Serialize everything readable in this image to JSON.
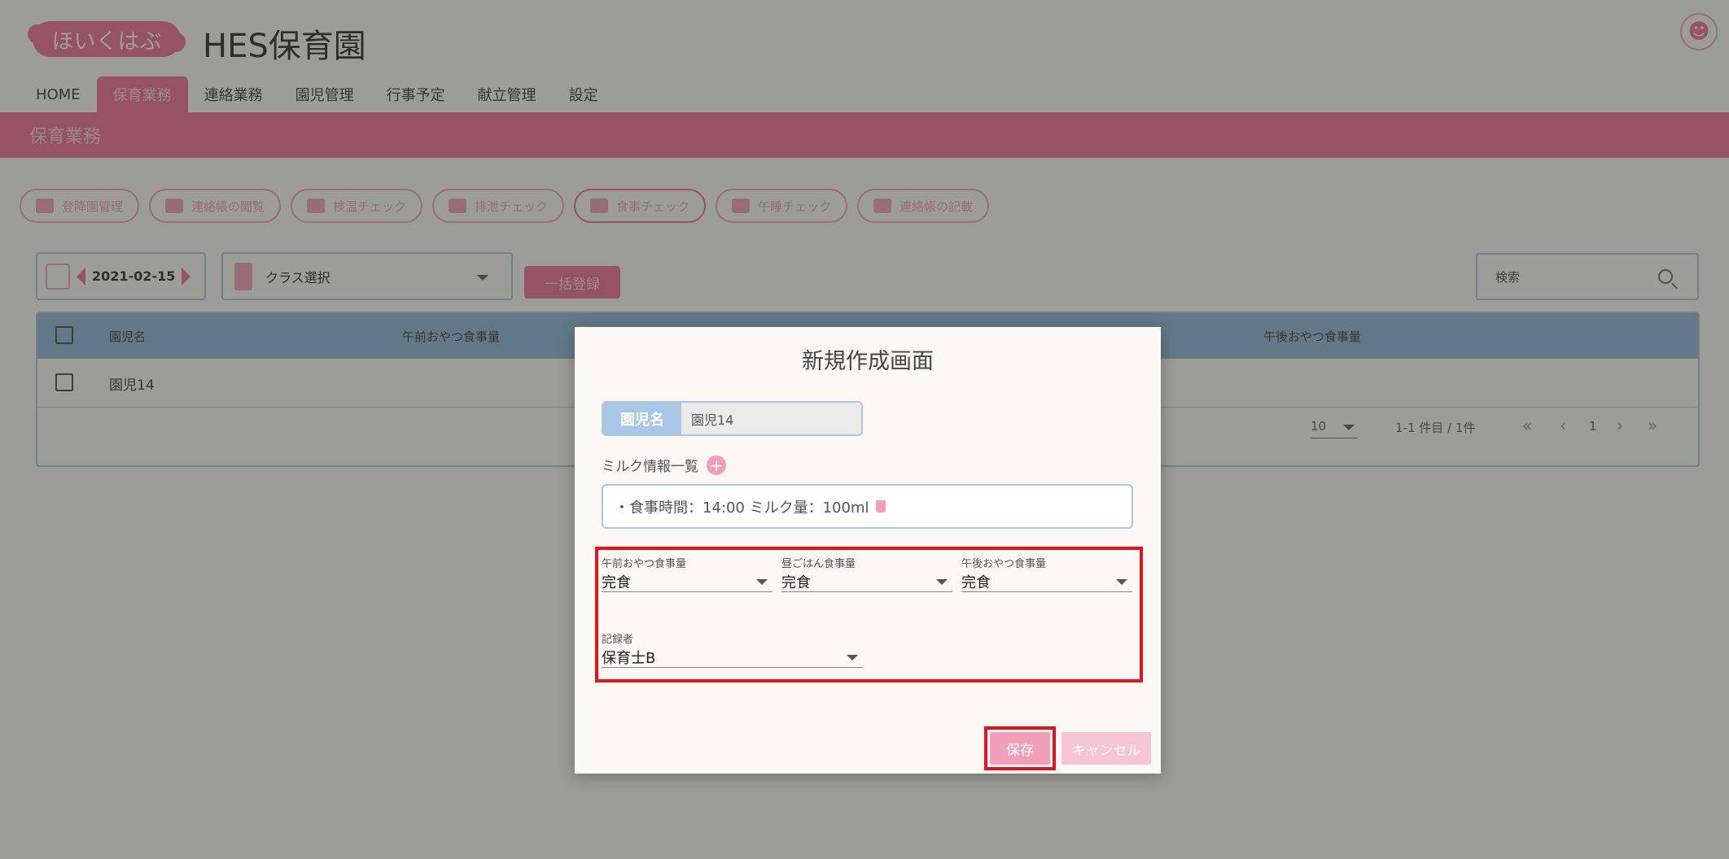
{
  "header": {
    "logo_text": "ほいくはぶ",
    "site_title": "HES保育園"
  },
  "nav": {
    "items": [
      {
        "label": "HOME",
        "active": false
      },
      {
        "label": "保育業務",
        "active": true
      },
      {
        "label": "連絡業務",
        "active": false
      },
      {
        "label": "園児管理",
        "active": false
      },
      {
        "label": "行事予定",
        "active": false
      },
      {
        "label": "献立管理",
        "active": false
      },
      {
        "label": "設定",
        "active": false
      }
    ]
  },
  "banner": {
    "title": "保育業務"
  },
  "subtabs": [
    {
      "label": "登降園管理",
      "icon": "tent-icon"
    },
    {
      "label": "連絡帳の閲覧",
      "icon": "list-icon"
    },
    {
      "label": "検温チェック",
      "icon": "thermometer-icon"
    },
    {
      "label": "排泄チェック",
      "icon": "duck-icon"
    },
    {
      "label": "食事チェック",
      "icon": "bowl-icon"
    },
    {
      "label": "午睡チェック",
      "icon": "moon-icon"
    },
    {
      "label": "連絡帳の記載",
      "icon": "notebook-icon"
    }
  ],
  "toolbar": {
    "date": "2021-02-15",
    "class_select": "クラス選択",
    "bulk_register": "一括登録",
    "search_placeholder": "検索"
  },
  "table": {
    "columns": [
      "園児名",
      "午前おやつ食事量",
      "午後おやつ食事量"
    ],
    "rows": [
      {
        "name": "園児14"
      }
    ],
    "pager": {
      "per_page": "10",
      "range": "1-1 件目 / 1件",
      "page": "1"
    }
  },
  "modal": {
    "title": "新規作成画面",
    "child_label": "園児名",
    "child_value": "園児14",
    "milk_label": "ミルク情報一覧",
    "milk_entry": "・食事時間：14:00 ミルク量：100ml",
    "fields": {
      "am_snack": {
        "label": "午前おやつ食事量",
        "value": "完食"
      },
      "lunch": {
        "label": "昼ごはん食事量",
        "value": "完食"
      },
      "pm_snack": {
        "label": "午後おやつ食事量",
        "value": "完食"
      },
      "recorder": {
        "label": "記録者",
        "value": "保育士B"
      }
    },
    "save_label": "保存",
    "cancel_label": "キャンセル"
  }
}
